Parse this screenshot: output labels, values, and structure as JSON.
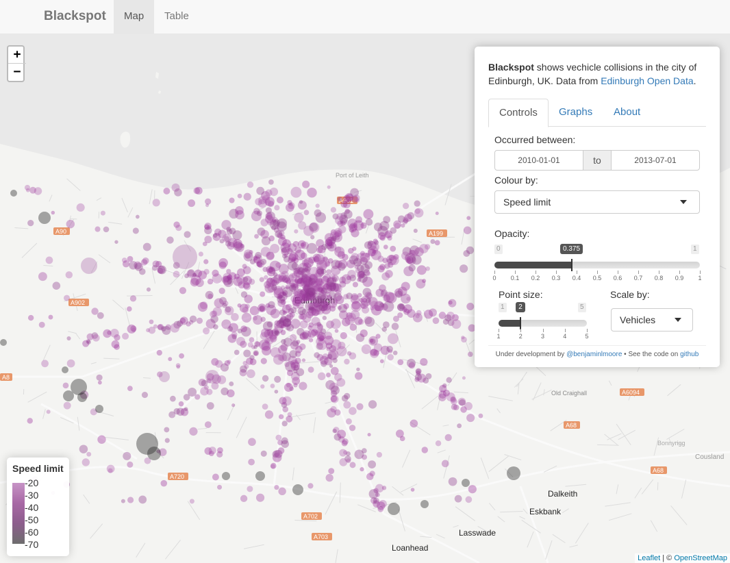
{
  "navbar": {
    "brand": "Blackspot",
    "tabs": [
      {
        "label": "Map",
        "active": true
      },
      {
        "label": "Table",
        "active": false
      }
    ]
  },
  "map": {
    "zoom_in": "+",
    "zoom_out": "−",
    "place_labels": [
      "Edinburgh",
      "Dalkeith",
      "Eskbank",
      "Lasswade",
      "Loanhead",
      "Old Craighall",
      "Cousland",
      "Port of Leith",
      "Bonnyrigg"
    ],
    "road_labels": [
      "A90",
      "A902",
      "A901",
      "A199",
      "A720",
      "A68",
      "A68",
      "A6094",
      "A702",
      "A703",
      "A8"
    ],
    "attribution": {
      "leaflet": "Leaflet",
      "sep": " | © ",
      "osm": "OpenStreetMap"
    }
  },
  "legend": {
    "title": "Speed limit",
    "values": [
      "20",
      "30",
      "40",
      "50",
      "60",
      "70"
    ],
    "colors": [
      "#c794c6",
      "#a868a5",
      "#8c5d8c",
      "#6e6e6e"
    ]
  },
  "panel": {
    "intro_brand": "Blackspot",
    "intro_text": " shows vechicle collisions in the city of Edinburgh, UK. Data from ",
    "intro_link": "Edinburgh Open Data",
    "intro_end": ".",
    "tabs": [
      {
        "label": "Controls",
        "active": true
      },
      {
        "label": "Graphs",
        "active": false
      },
      {
        "label": "About",
        "active": false
      }
    ],
    "occurred_label": "Occurred between:",
    "date_from": "2010-01-01",
    "date_to_label": "to",
    "date_to": "2013-07-01",
    "colour_label": "Colour by:",
    "colour_value": "Speed limit",
    "opacity": {
      "label": "Opacity:",
      "min": "0",
      "max": "1",
      "value_label": "0.375",
      "value": 0.375,
      "ticks": [
        "0",
        "0.1",
        "0.2",
        "0.3",
        "0.4",
        "0.5",
        "0.6",
        "0.7",
        "0.8",
        "0.9",
        "1"
      ]
    },
    "point_size": {
      "label": "Point size:",
      "min": "1",
      "max": "5",
      "value_label": "2",
      "value": 2,
      "ticks": [
        "1",
        "2",
        "3",
        "4",
        "5"
      ]
    },
    "scale_label": "Scale by:",
    "scale_value": "Vehicles",
    "footer": {
      "text1": "Under development by ",
      "author": "@benjaminlmoore",
      "text2": " • See the code on ",
      "github": "github"
    }
  }
}
